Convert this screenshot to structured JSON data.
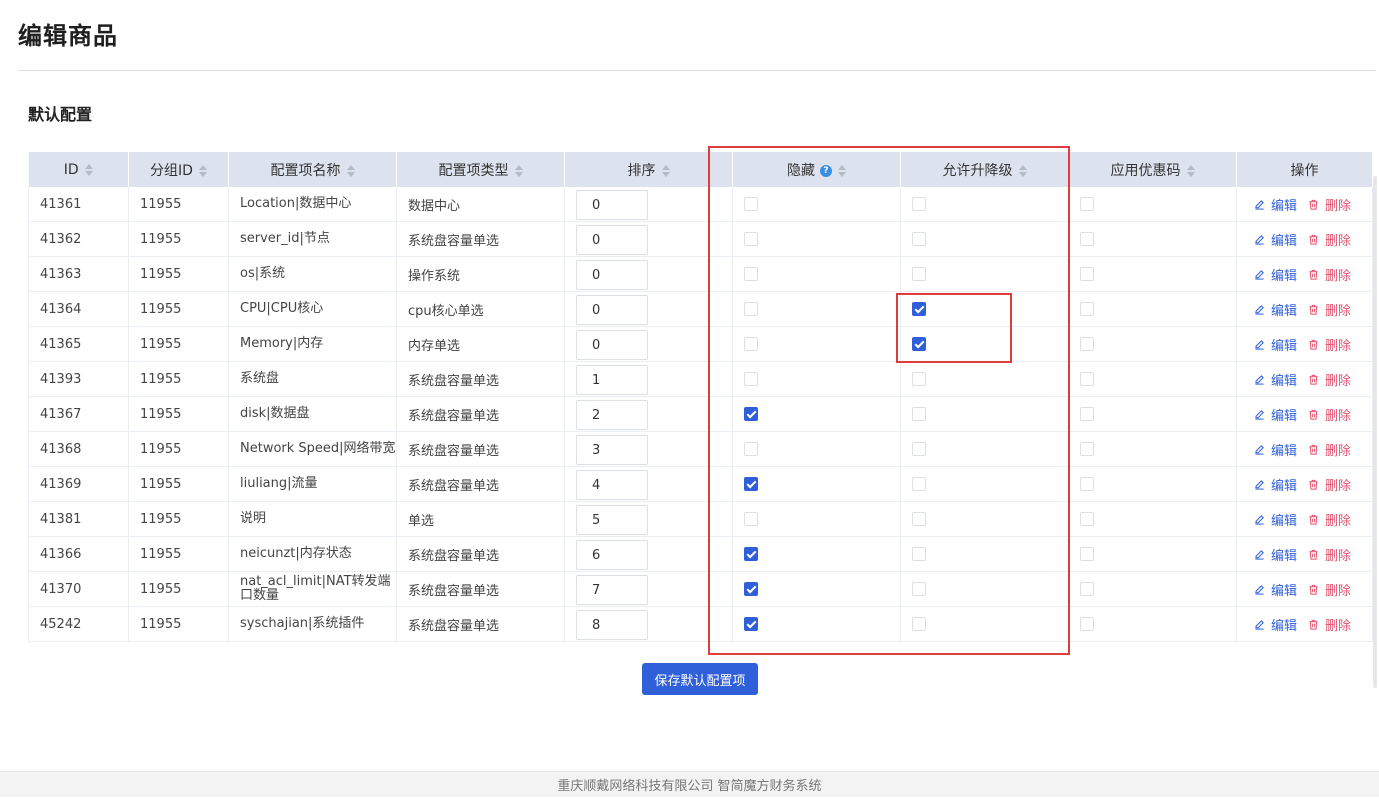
{
  "page": {
    "title": "编辑商品"
  },
  "section": {
    "title": "默认配置"
  },
  "table": {
    "columns": {
      "id": "ID",
      "group_id": "分组ID",
      "name": "配置项名称",
      "type": "配置项类型",
      "sort": "排序",
      "hidden": "隐藏",
      "upgrade": "允许升降级",
      "coupon": "应用优惠码",
      "ops": "操作"
    },
    "rows": [
      {
        "id": "41361",
        "group_id": "11955",
        "name": "Location|数据中心",
        "type": "数据中心",
        "sort": "0",
        "hidden": false,
        "upgrade": false,
        "coupon": false
      },
      {
        "id": "41362",
        "group_id": "11955",
        "name": "server_id|节点",
        "type": "系统盘容量单选",
        "sort": "0",
        "hidden": false,
        "upgrade": false,
        "coupon": false
      },
      {
        "id": "41363",
        "group_id": "11955",
        "name": "os|系统",
        "type": "操作系统",
        "sort": "0",
        "hidden": false,
        "upgrade": false,
        "coupon": false
      },
      {
        "id": "41364",
        "group_id": "11955",
        "name": "CPU|CPU核心",
        "type": "cpu核心单选",
        "sort": "0",
        "hidden": false,
        "upgrade": true,
        "coupon": false
      },
      {
        "id": "41365",
        "group_id": "11955",
        "name": "Memory|内存",
        "type": "内存单选",
        "sort": "0",
        "hidden": false,
        "upgrade": true,
        "coupon": false
      },
      {
        "id": "41393",
        "group_id": "11955",
        "name": "系统盘",
        "type": "系统盘容量单选",
        "sort": "1",
        "hidden": false,
        "upgrade": false,
        "coupon": false
      },
      {
        "id": "41367",
        "group_id": "11955",
        "name": "disk|数据盘",
        "type": "系统盘容量单选",
        "sort": "2",
        "hidden": true,
        "upgrade": false,
        "coupon": false
      },
      {
        "id": "41368",
        "group_id": "11955",
        "name": "Network Speed|网络带宽",
        "type": "系统盘容量单选",
        "sort": "3",
        "hidden": false,
        "upgrade": false,
        "coupon": false
      },
      {
        "id": "41369",
        "group_id": "11955",
        "name": "liuliang|流量",
        "type": "系统盘容量单选",
        "sort": "4",
        "hidden": true,
        "upgrade": false,
        "coupon": false
      },
      {
        "id": "41381",
        "group_id": "11955",
        "name": "说明",
        "type": "单选",
        "sort": "5",
        "hidden": false,
        "upgrade": false,
        "coupon": false
      },
      {
        "id": "41366",
        "group_id": "11955",
        "name": "neicunzt|内存状态",
        "type": "系统盘容量单选",
        "sort": "6",
        "hidden": true,
        "upgrade": false,
        "coupon": false
      },
      {
        "id": "41370",
        "group_id": "11955",
        "name": "nat_acl_limit|NAT转发端口数量",
        "type": "系统盘容量单选",
        "sort": "7",
        "hidden": true,
        "upgrade": false,
        "coupon": false
      },
      {
        "id": "45242",
        "group_id": "11955",
        "name": "syschajian|系统插件",
        "type": "系统盘容量单选",
        "sort": "8",
        "hidden": true,
        "upgrade": false,
        "coupon": false
      }
    ],
    "actions": {
      "edit": "编辑",
      "delete": "删除"
    }
  },
  "save_button": "保存默认配置项",
  "footer": "重庆顺戴网络科技有限公司 智简魔方财务系统",
  "icons": {
    "sort": "sort-caret-icon",
    "help": "question-circle-icon",
    "edit": "pencil-icon",
    "delete": "trash-icon"
  },
  "colors": {
    "accent": "#2f5fd9",
    "danger": "#e0526f",
    "highlight": "#e03c3c",
    "header_bg": "#dde3ee"
  }
}
